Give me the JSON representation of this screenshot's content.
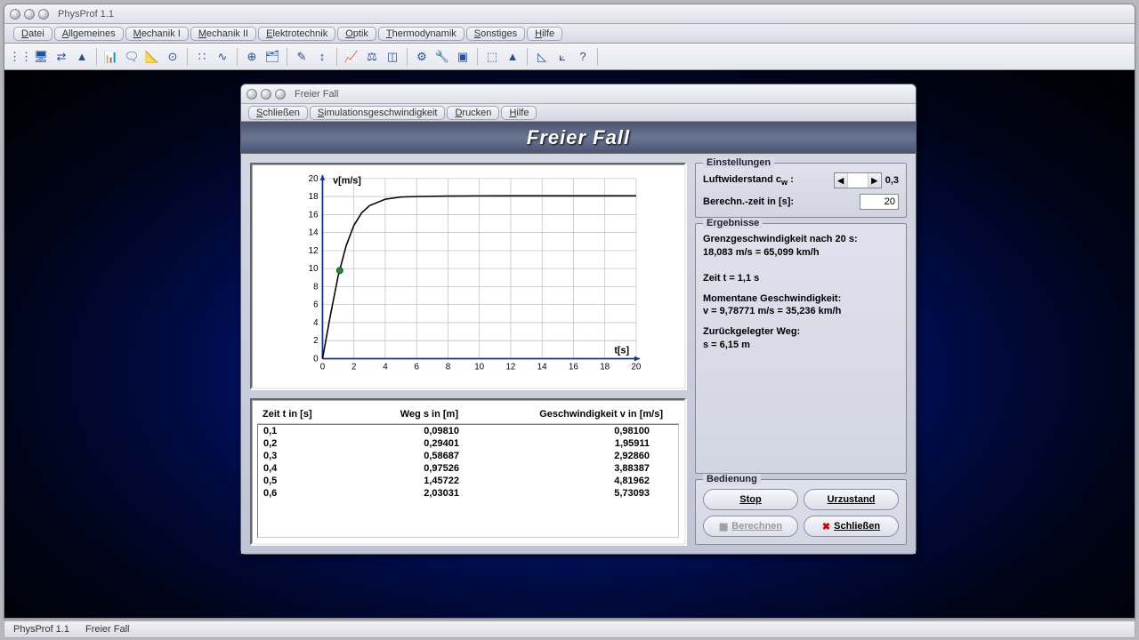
{
  "app": {
    "title": "PhysProf 1.1"
  },
  "menus": [
    "Datei",
    "Allgemeines",
    "Mechanik I",
    "Mechanik II",
    "Elektrotechnik",
    "Optik",
    "Thermodynamik",
    "Sonstiges",
    "Hilfe"
  ],
  "toolbar_icons": [
    "⋮⋮",
    "🖥",
    "⇄",
    "▲",
    "📊",
    "🗨",
    "📐",
    "⊙",
    "∷",
    "∿",
    "⊕",
    "🗂",
    "✎",
    "↕",
    "📈",
    "⚖",
    "◫",
    "⚙",
    "🔧",
    "▣",
    "⬚",
    "▲",
    "◺",
    "⟀",
    "?"
  ],
  "subwin": {
    "title": "Freier Fall",
    "menus": [
      "Schließen",
      "Simulationsgeschwindigkeit",
      "Drucken",
      "Hilfe"
    ],
    "banner": "Freier Fall"
  },
  "settings": {
    "group": "Einstellungen",
    "airres_label": "Luftwiderstand c",
    "airres_sub": "w",
    "airres_sep": " :",
    "airres_val": "0,3",
    "time_label": "Berechn.-zeit in [s]:",
    "time_val": "20"
  },
  "results": {
    "group": "Ergebnisse",
    "line1": "Grenzgeschwindigkeit nach 20 s:",
    "line2": "18,083 m/s = 65,099 km/h",
    "line3": "Zeit t = 1,1 s",
    "line4": "Momentane Geschwindigkeit:",
    "line5": "v = 9,78771 m/s = 35,236 km/h",
    "line6": "Zurückgelegter Weg:",
    "line7": "s = 6,15 m"
  },
  "controls": {
    "group": "Bedienung",
    "stop": "Stop",
    "reset": "Urzustand",
    "calc": "Berechnen",
    "close": "Schließen"
  },
  "table": {
    "h1": "Zeit t in [s]",
    "h2": "Weg s in [m]",
    "h3": "Geschwindigkeit v in [m/s]",
    "rows": [
      {
        "t": "0,1",
        "s": "0,09810",
        "v": "0,98100"
      },
      {
        "t": "0,2",
        "s": "0,29401",
        "v": "1,95911"
      },
      {
        "t": "0,3",
        "s": "0,58687",
        "v": "2,92860"
      },
      {
        "t": "0,4",
        "s": "0,97526",
        "v": "3,88387"
      },
      {
        "t": "0,5",
        "s": "1,45722",
        "v": "4,81962"
      },
      {
        "t": "0,6",
        "s": "2,03031",
        "v": "5,73093"
      }
    ]
  },
  "chart": {
    "ylabel": "v[m/s]",
    "xlabel": "t[s]",
    "xticks": [
      "0",
      "2",
      "4",
      "6",
      "8",
      "10",
      "12",
      "14",
      "16",
      "18",
      "20"
    ],
    "yticks": [
      "0",
      "2",
      "4",
      "6",
      "8",
      "10",
      "12",
      "14",
      "16",
      "18",
      "20"
    ]
  },
  "chart_data": {
    "type": "line",
    "title": "Freier Fall — v[m/s] über t[s]",
    "xlabel": "t[s]",
    "ylabel": "v[m/s]",
    "xlim": [
      0,
      20
    ],
    "ylim": [
      0,
      20
    ],
    "x": [
      0,
      0.5,
      1,
      1.5,
      2,
      2.5,
      3,
      4,
      5,
      6,
      8,
      10,
      12,
      14,
      16,
      18,
      20
    ],
    "values": [
      0,
      4.8,
      9.2,
      12.5,
      14.8,
      16.2,
      17.0,
      17.7,
      17.95,
      18.0,
      18.05,
      18.07,
      18.08,
      18.08,
      18.08,
      18.08,
      18.083
    ],
    "marker": {
      "t": 1.1,
      "v": 9.78771
    },
    "asymptote": 18.083
  },
  "taskbar": {
    "a": "PhysProf 1.1",
    "b": "Freier Fall"
  }
}
